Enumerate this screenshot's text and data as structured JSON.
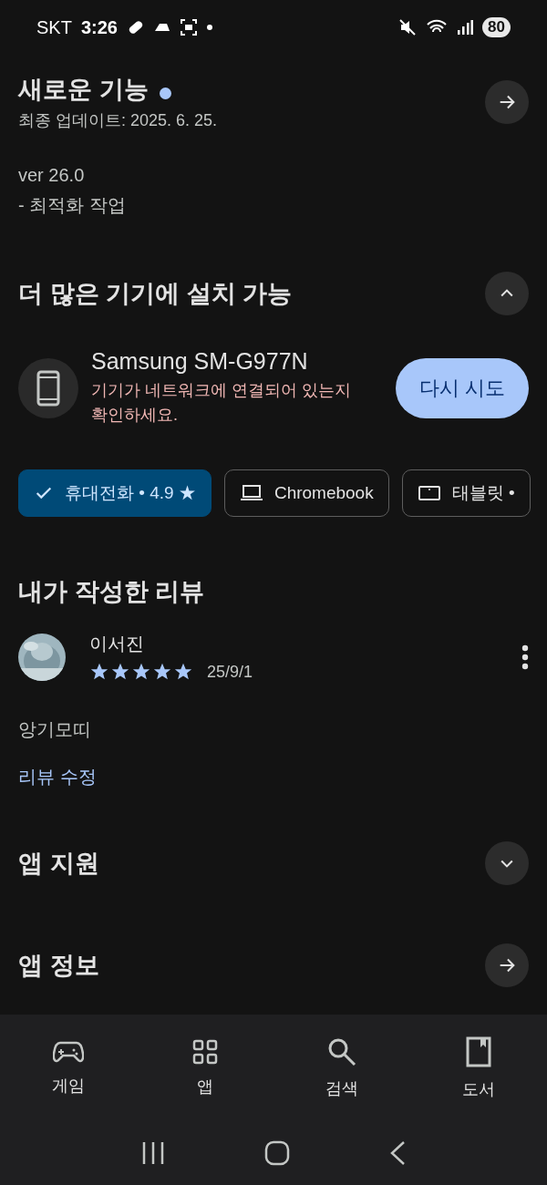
{
  "status_bar": {
    "carrier": "SKT",
    "time": "3:26",
    "battery": "80"
  },
  "whats_new": {
    "title": "새로운 기능",
    "updated": "최종 업데이트: 2025. 6. 25.",
    "lines": [
      "ver 26.0",
      "- 최적화 작업"
    ]
  },
  "devices_section": {
    "title": "더 많은 기기에 설치 가능",
    "expanded": true
  },
  "device": {
    "name": "Samsung SM-G977N",
    "error": "기기가 네트워크에 연결되어 있는지 확인하세요.",
    "button": "다시 시도"
  },
  "chips": [
    {
      "label": "휴대전화 • 4.9 ★",
      "selected": true
    },
    {
      "kind": "laptop",
      "label": "Chromebook",
      "selected": false
    },
    {
      "kind": "tablet",
      "label": "태블릿 •",
      "selected": false
    }
  ],
  "review": {
    "title": "내가 작성한 리뷰",
    "author": "이서진",
    "stars": 5,
    "date": "25/9/1",
    "text": "앙기모띠",
    "edit_link": "리뷰 수정"
  },
  "sections": [
    {
      "kind": "toggle",
      "title": "앱 지원",
      "expanded": false
    },
    {
      "kind": "link",
      "title": "앱 정보"
    }
  ],
  "bottom_nav": [
    {
      "kind": "games",
      "label": "게임"
    },
    {
      "kind": "apps",
      "label": "앱"
    },
    {
      "kind": "search",
      "label": "검색"
    },
    {
      "kind": "books",
      "label": "도서"
    }
  ]
}
